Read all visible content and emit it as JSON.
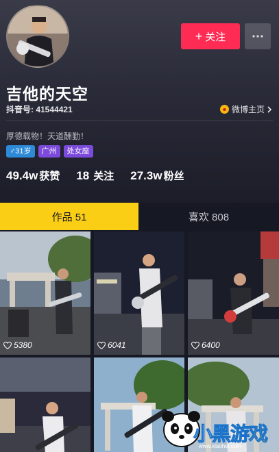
{
  "profile": {
    "name": "吉他的天空",
    "douyin_id": "抖音号: 41544421",
    "weibo_link": "微博主页",
    "bio": "厚德载物！天道酬勤！",
    "tags": {
      "age": "♂31岁",
      "city": "广州",
      "sign": "处女座"
    }
  },
  "actions": {
    "follow_label": "关注",
    "follow_plus": "+",
    "more_icon": "more-dots-icon"
  },
  "stats": {
    "likes_num": "49.4w",
    "likes_label": "获赞",
    "following_num": "18",
    "following_label": "关注",
    "fans_num": "27.3w",
    "fans_label": "粉丝"
  },
  "tabs": {
    "works": "作品 51",
    "likes": "喜欢 808"
  },
  "videos": [
    {
      "likes": "5380"
    },
    {
      "likes": "6041"
    },
    {
      "likes": "6400"
    },
    {
      "likes": ""
    },
    {
      "likes": ""
    },
    {
      "likes": ""
    }
  ],
  "watermark": {
    "text_main": "小黑",
    "text_accent": "游戏",
    "url": "www.xiaohei.com"
  },
  "colors": {
    "accent": "#fe2c55",
    "tab_active": "#face15",
    "background": "#161823"
  }
}
